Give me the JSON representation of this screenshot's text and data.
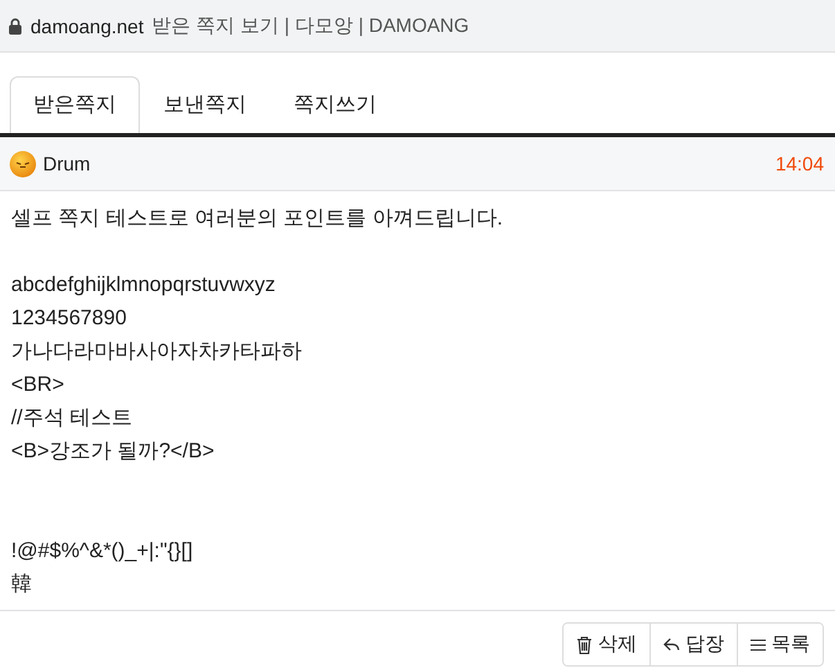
{
  "browser": {
    "domain": "damoang.net",
    "title": "받은 쪽지 보기 | 다모앙 | DAMOANG"
  },
  "tabs": [
    {
      "label": "받은쪽지",
      "selected": true
    },
    {
      "label": "보낸쪽지",
      "selected": false
    },
    {
      "label": "쪽지쓰기",
      "selected": false
    }
  ],
  "message": {
    "sender": "Drum",
    "time": "14:04",
    "lines": [
      {
        "kind": "text",
        "text": "셀프 쪽지 테스트로 여러분의 포인트를 아껴드립니다."
      },
      {
        "kind": "blank"
      },
      {
        "kind": "text",
        "text": "abcdefghijklmnopqrstuvwxyz"
      },
      {
        "kind": "text",
        "text": "1234567890"
      },
      {
        "kind": "text",
        "text": "가나다라마바사아자차카타파하"
      },
      {
        "kind": "text",
        "text": "<BR>"
      },
      {
        "kind": "text",
        "text": "//주석 테스트"
      },
      {
        "kind": "text",
        "text": "<B>강조가 될까?</B>"
      },
      {
        "kind": "blank"
      },
      {
        "kind": "blank"
      },
      {
        "kind": "text",
        "text": "!@#$%^&*()_+|:\"{}[]"
      },
      {
        "kind": "text",
        "text": "韓"
      }
    ]
  },
  "actions": [
    {
      "kind": "delete",
      "label": "삭제"
    },
    {
      "kind": "reply",
      "label": "답장"
    },
    {
      "kind": "list",
      "label": "목록"
    }
  ]
}
